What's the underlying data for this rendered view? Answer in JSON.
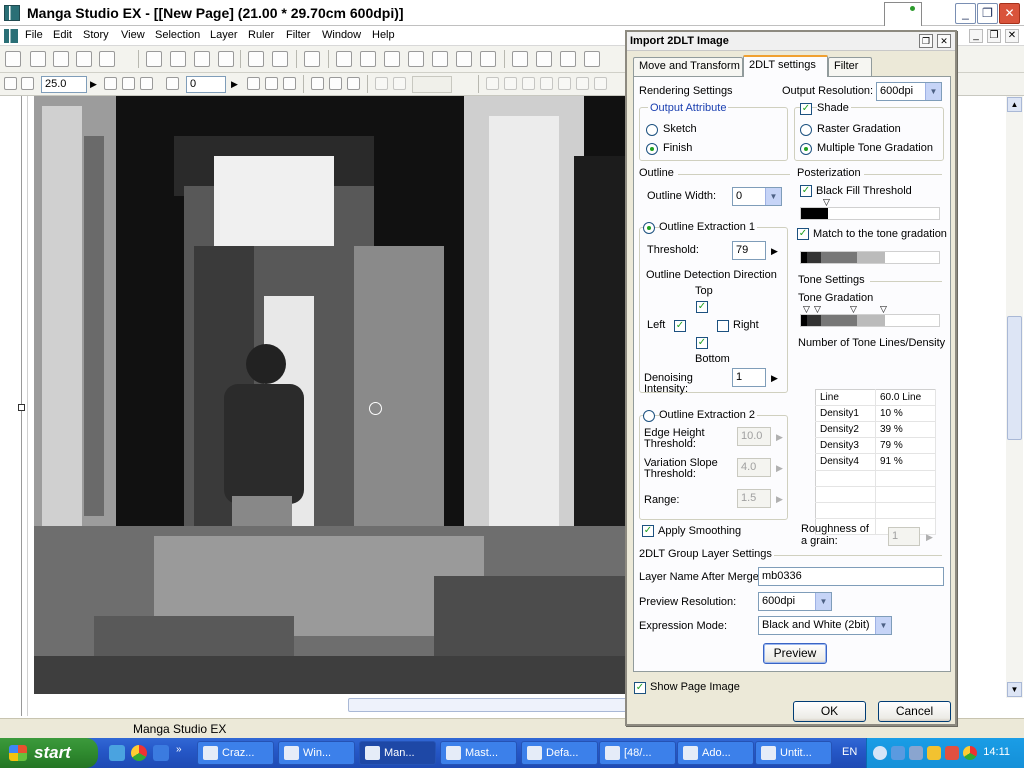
{
  "app": {
    "title": "Manga Studio EX - [[New Page] (21.00 * 29.70cm 600dpi)]",
    "win_minimize": "_",
    "win_restore": "❐",
    "win_close": "✕"
  },
  "menu": {
    "items": [
      "File",
      "Edit",
      "Story",
      "View",
      "Selection",
      "Layer",
      "Ruler",
      "Filter",
      "Window",
      "Help"
    ],
    "mdi_minimize": "_",
    "mdi_restore": "❐",
    "mdi_close": "✕"
  },
  "toolbar": {
    "zoom_value": "25.0",
    "rotation_value": "0"
  },
  "statusbar": {
    "text": "Manga Studio EX"
  },
  "taskbar": {
    "start_label": "start",
    "buttons": [
      {
        "label": "Craz...",
        "active": false
      },
      {
        "label": "Win...",
        "active": false
      },
      {
        "label": "Man...",
        "active": true
      },
      {
        "label": "Mast...",
        "active": false
      },
      {
        "label": "Defa...",
        "active": false
      },
      {
        "label": "[48/...",
        "active": false
      },
      {
        "label": "Ado...",
        "active": false
      },
      {
        "label": "Untit...",
        "active": false
      }
    ],
    "language": "EN",
    "clock": "14:11"
  },
  "dialog": {
    "title": "Import 2DLT Image",
    "tabs": [
      {
        "label": "Move and Transform",
        "active": false
      },
      {
        "label": "2DLT settings",
        "active": true
      },
      {
        "label": "Filter",
        "active": false
      }
    ],
    "rendering_settings": "Rendering Settings",
    "output_resolution_label": "Output Resolution:",
    "output_resolution_value": "600dpi",
    "output_attribute": "Output Attribute",
    "sketch": "Sketch",
    "finish": "Finish",
    "shade": "Shade",
    "raster_gradation": "Raster Gradation",
    "multiple_tone_gradation": "Multiple Tone Gradation",
    "outline": "Outline",
    "outline_width_label": "Outline Width:",
    "outline_width_value": "0",
    "outline_extraction_1": "Outline Extraction 1",
    "threshold_label": "Threshold:",
    "threshold_value": "79",
    "detection_direction": "Outline Detection Direction",
    "top": "Top",
    "left": "Left",
    "right": "Right",
    "bottom": "Bottom",
    "denoising_label_1": "Denoising",
    "denoising_label_2": "Intensity:",
    "denoising_value": "1",
    "outline_extraction_2": "Outline Extraction 2",
    "edge_height_1": "Edge Height",
    "edge_height_2": "Threshold:",
    "edge_height_value": "10.0",
    "variation_slope_1": "Variation Slope",
    "variation_slope_2": "Threshold:",
    "variation_slope_value": "4.0",
    "range_label": "Range:",
    "range_value": "1.5",
    "apply_smoothing": "Apply Smoothing",
    "posterization": "Posterization",
    "black_fill_threshold": "Black Fill Threshold",
    "match_tone_gradation": "Match to the tone gradation",
    "tone_settings": "Tone Settings",
    "tone_gradation": "Tone Gradation",
    "number_tone_lines": "Number of Tone Lines/Density",
    "tone_rows": [
      {
        "name": "Line",
        "value": "60.0 Line"
      },
      {
        "name": "Density1",
        "value": "10 %"
      },
      {
        "name": "Density2",
        "value": "39 %"
      },
      {
        "name": "Density3",
        "value": "79 %"
      },
      {
        "name": "Density4",
        "value": "91 %"
      }
    ],
    "roughness_1": "Roughness of",
    "roughness_2": "a grain:",
    "roughness_value": "1",
    "group_layer_settings": "2DLT Group Layer Settings",
    "layer_name_label": "Layer Name After Merge:",
    "layer_name_value": "mb0336",
    "preview_resolution_label": "Preview Resolution:",
    "preview_resolution_value": "600dpi",
    "expression_mode_label": "Expression Mode:",
    "expression_mode_value": "Black and White (2bit)",
    "preview_button": "Preview",
    "show_page_image": "Show Page Image",
    "ok_button": "OK",
    "cancel_button": "Cancel"
  }
}
